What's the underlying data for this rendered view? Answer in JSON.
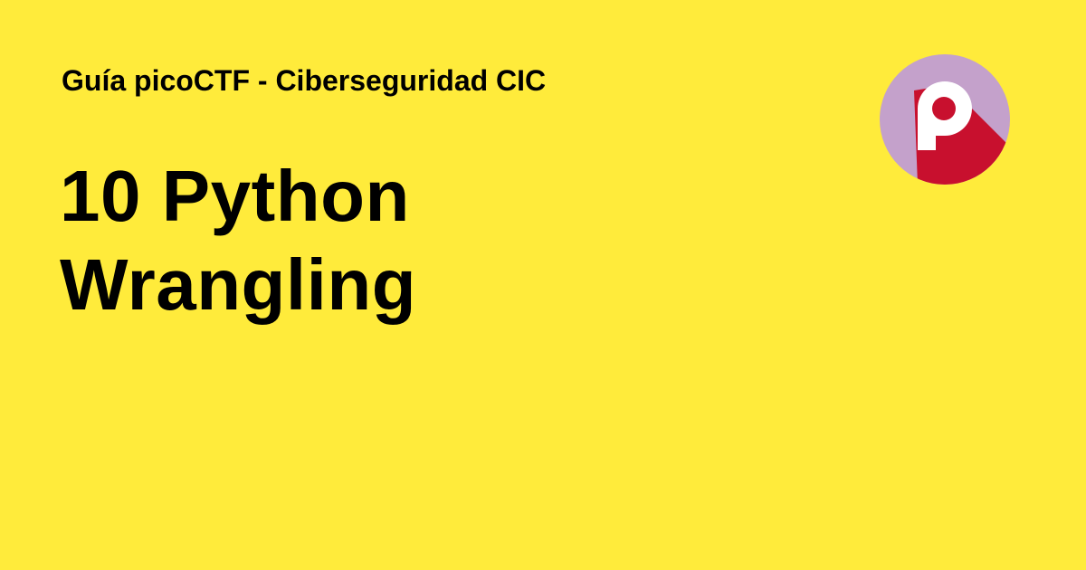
{
  "colors": {
    "background": "#FFEB3B",
    "text": "#000000",
    "logo_circle": "#C4A1CB",
    "logo_shadow": "#C8102E",
    "logo_letter": "#FFFFFF",
    "logo_dot": "#C8102E"
  },
  "header": {
    "subtitle": "Guía picoCTF - Ciberseguridad CIC"
  },
  "main": {
    "title_lines": [
      "10 Python",
      "Wrangling"
    ]
  },
  "logo": {
    "icon": "p-letter-logo-icon"
  }
}
